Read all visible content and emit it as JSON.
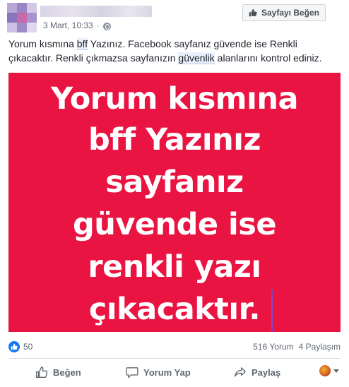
{
  "post": {
    "date": "3 Mart, 10:33",
    "separator": "·",
    "like_page_label": "Sayfayı Beğen",
    "text_parts": [
      "Yorum kısmına ",
      "bff",
      " Yazınız. Facebook sayfanız güvende ise Renkli çıkacaktır. Renkli çıkmazsa sayfanızın ",
      "güvenlik",
      " alanlarını kontrol ediniz."
    ],
    "image_lines": [
      "Yorum kısmına",
      "bff Yazınız",
      "sayfanız",
      "güvende ise",
      "renkli yazı",
      "çıkacaktır."
    ],
    "image_bg_color": "#ea1443"
  },
  "stats": {
    "likes": "50",
    "comments": "516 Yorum",
    "shares": "4 Paylaşım"
  },
  "actions": {
    "like": "Beğen",
    "comment": "Yorum Yap",
    "share": "Paylaş"
  },
  "icons": {
    "like_page": "thumbs-up-icon",
    "like": "thumbs-up-icon",
    "comment": "speech-bubble-icon",
    "share": "share-arrow-icon",
    "privacy": "globe-icon",
    "profile_selector": "chevron-down-icon"
  }
}
